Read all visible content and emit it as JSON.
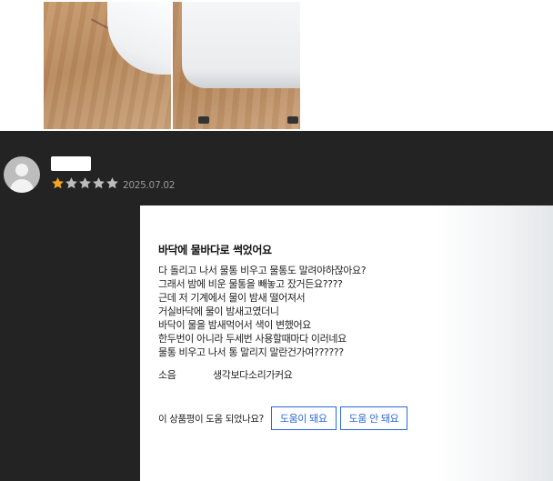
{
  "review": {
    "date": "2025.07.02",
    "rating": 1,
    "rating_max": 5,
    "title": "바닥에 물바다로 썩었어요",
    "body_lines": [
      "다 돌리고 나서 물통 비우고 물통도 말려야하잖아요?",
      "그래서 밤에 비운 물통을 빼놓고 잤거든요????",
      "근데 저 기계에서 물이 밤새 떨어져서",
      "거실바닥에 물이 밤새고였더니",
      "바닥이 물을 밤새먹어서 색이 변했어요",
      "한두번이 아니라 두세번 사용할때마다 이러네요",
      "물통 비우고 나서 통 말리지 말란건가여??????"
    ],
    "attribute": {
      "label": "소음",
      "value": "생각보다소리가커요"
    },
    "helpful": {
      "question": "이 상품평이 도움 되었나요?",
      "yes_label": "도움이 돼요",
      "no_label": "도움 안 돼요"
    }
  },
  "colors": {
    "panel_bg": "#232323",
    "star_filled": "#f5a623",
    "star_empty": "#bdbdbd",
    "button_accent": "#2c6ad6"
  },
  "icons": {
    "avatar": "default-user-avatar-icon",
    "star": "star-icon"
  }
}
